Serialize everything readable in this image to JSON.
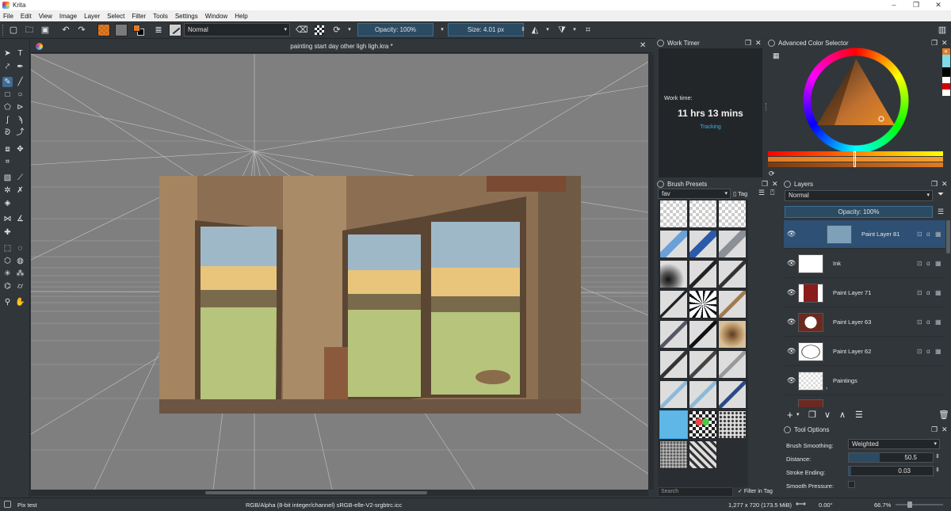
{
  "window": {
    "title": "Krita"
  },
  "menu": [
    "File",
    "Edit",
    "View",
    "Image",
    "Layer",
    "Select",
    "Filter",
    "Tools",
    "Settings",
    "Window",
    "Help"
  ],
  "toolbar": {
    "blend_mode": "Normal",
    "opacity": "Opacity: 100%",
    "size": "Size: 4.01 px"
  },
  "document": {
    "tab_title": "painting start day other ligh ligh.kra *"
  },
  "work_timer": {
    "title": "Work Timer",
    "label": "Work time:",
    "value": "11 hrs 13 mins",
    "status": "Tracking"
  },
  "color_selector": {
    "title": "Advanced Color Selector"
  },
  "brush_presets": {
    "title": "Brush Presets",
    "tag_value": "fav",
    "tag_button": "Tag",
    "search_placeholder": "Search",
    "filter_in_tag": "Filter in Tag"
  },
  "layers": {
    "title": "Layers",
    "blend_mode": "Normal",
    "opacity": "Opacity:  100%",
    "items": [
      {
        "name": "Paint Layer 81",
        "selected": true
      },
      {
        "name": "Ink",
        "selected": false
      },
      {
        "name": "Paint Layer 71",
        "selected": false
      },
      {
        "name": "Paint Layer 63",
        "selected": false
      },
      {
        "name": "Paint Layer 62",
        "selected": false
      },
      {
        "name": "Paintings",
        "selected": false
      }
    ]
  },
  "tool_options": {
    "title": "Tool Options",
    "brush_smoothing_label": "Brush Smoothing:",
    "brush_smoothing_value": "Weighted",
    "distance_label": "Distance:",
    "distance_value": "50.5",
    "stroke_ending_label": "Stroke Ending:",
    "stroke_ending_value": "0.03",
    "smooth_pressure_label": "Smooth Pressure:"
  },
  "status": {
    "brush": "Pix test",
    "color_space": "RGB/Alpha (8-bit integer/channel)  sRGB-elle-V2-srgbtrc.icc",
    "dimensions": "1,277 x 720 (173.5 MiB)",
    "rotation": "0.00°",
    "zoom": "66.7%"
  },
  "colors": {
    "accent": "#3d6c94",
    "panel": "#31363b",
    "panel_dark": "#232629",
    "canvas_bg": "#7f7f7f",
    "fg_color": "#e07b24",
    "bg_color": "#000000"
  }
}
